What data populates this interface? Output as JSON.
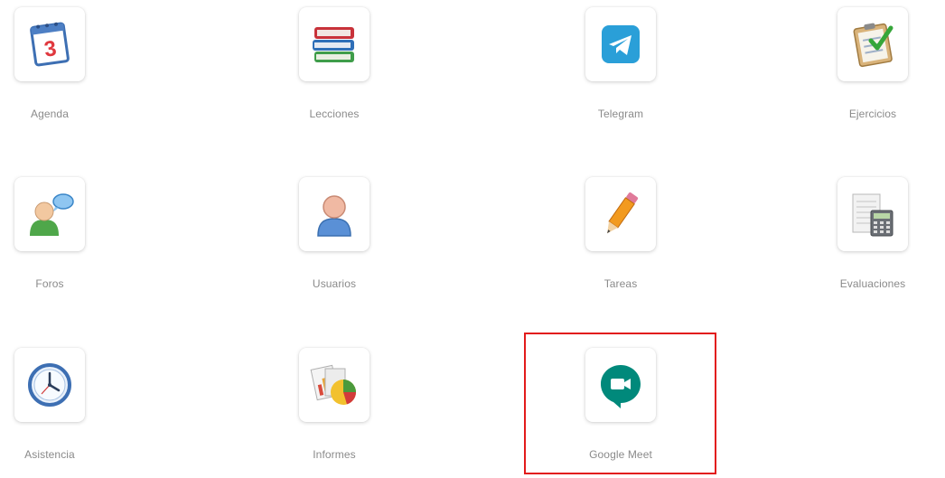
{
  "tools": {
    "agenda": {
      "label": "Agenda",
      "icon": "calendar-icon"
    },
    "lecciones": {
      "label": "Lecciones",
      "icon": "books-icon"
    },
    "telegram": {
      "label": "Telegram",
      "icon": "telegram-icon"
    },
    "ejercicios": {
      "label": "Ejercicios",
      "icon": "checklist-icon"
    },
    "foros": {
      "label": "Foros",
      "icon": "forum-user-icon"
    },
    "usuarios": {
      "label": "Usuarios",
      "icon": "user-icon"
    },
    "tareas": {
      "label": "Tareas",
      "icon": "pencil-icon"
    },
    "evaluaciones": {
      "label": "Evaluaciones",
      "icon": "calculator-sheet-icon"
    },
    "asistencia": {
      "label": "Asistencia",
      "icon": "clock-icon"
    },
    "informes": {
      "label": "Informes",
      "icon": "reports-chart-icon"
    },
    "meet": {
      "label": "Google Meet",
      "icon": "google-meet-icon"
    }
  },
  "calendar_day": "3",
  "colors": {
    "label_text": "#8a8a8a",
    "highlight_border": "#e21b1b",
    "telegram_blue": "#2a9fd8",
    "meet_green": "#00897b"
  }
}
